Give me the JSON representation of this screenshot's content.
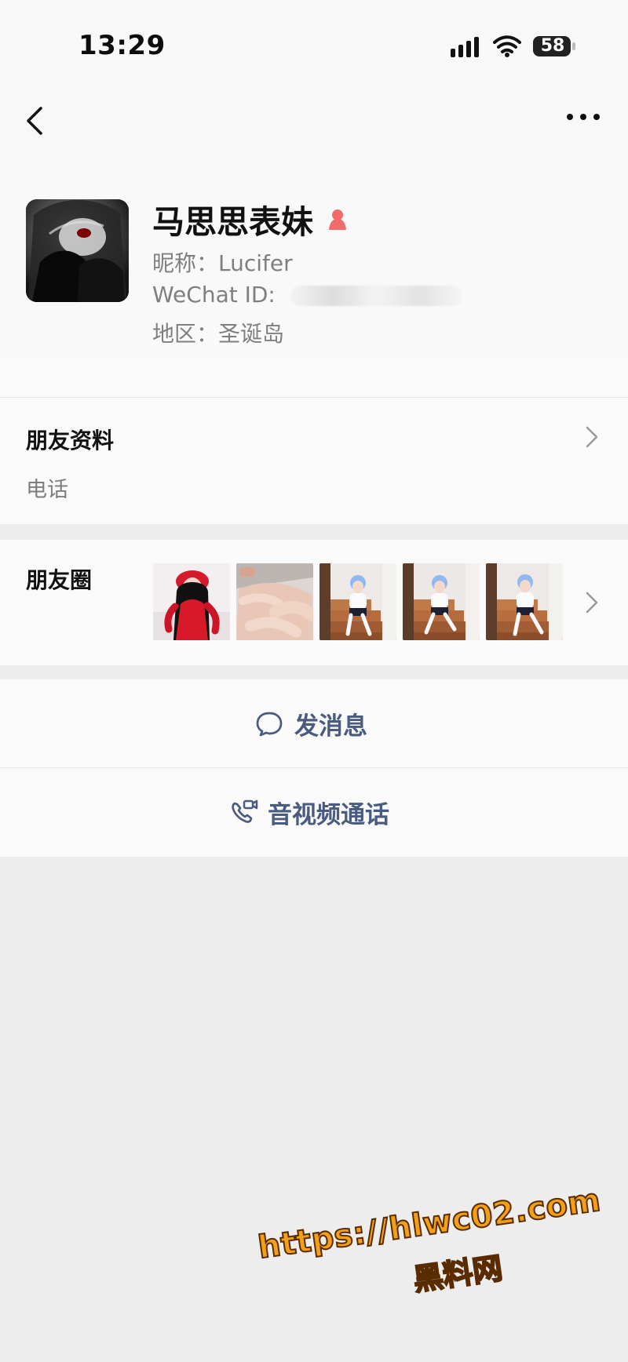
{
  "status_bar": {
    "time": "13:29",
    "battery": "58",
    "signal_icon": "signal-icon",
    "wifi_icon": "wifi-icon"
  },
  "navigation": {
    "back_icon": "chevron-left-icon",
    "more_icon": "more-icon"
  },
  "profile": {
    "display_name": "马思思表妹",
    "gender_icon": "female-icon",
    "nickname_line": "昵称：Lucifer",
    "wechat_id_label": "WeChat ID:",
    "region_line": "地区：圣诞岛"
  },
  "friend_info": {
    "title": "朋友资料",
    "phone_label": "电话"
  },
  "moments": {
    "label": "朋友圈",
    "thumbnails": [
      "thumbnail-red-outfit",
      "thumbnail-blurred-closeup",
      "thumbnail-stairs-1",
      "thumbnail-stairs-2",
      "thumbnail-stairs-3"
    ]
  },
  "actions": {
    "message": "发消息",
    "call": "音视频通话",
    "message_icon": "chat-bubble-icon",
    "call_icon": "phone-video-icon"
  },
  "watermark": {
    "url": "https://hlwc02.com",
    "text": "黑料网"
  },
  "colors": {
    "background": "#ededed",
    "panel": "#fafafa",
    "action_blue": "#4a5b80",
    "gender_red": "#f06b6b",
    "watermark_orange": "#f2a116"
  }
}
